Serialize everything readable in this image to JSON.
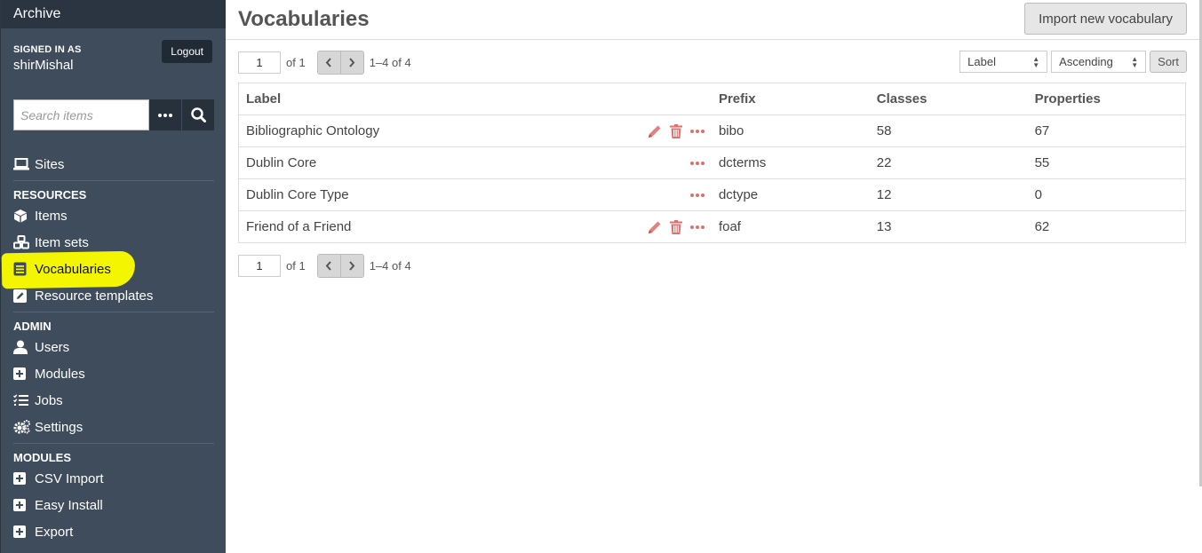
{
  "sidebar": {
    "site_title": "Archive",
    "signed_in_label": "SIGNED IN AS",
    "username": "shirMishal",
    "logout_label": "Logout",
    "search_placeholder": "Search items",
    "sites_label": "Sites",
    "resources_heading": "RESOURCES",
    "items_label": "Items",
    "item_sets_label": "Item sets",
    "vocabularies_label": "Vocabularies",
    "resource_templates_label": "Resource templates",
    "admin_heading": "ADMIN",
    "users_label": "Users",
    "modules_label": "Modules",
    "jobs_label": "Jobs",
    "settings_label": "Settings",
    "modules_heading": "MODULES",
    "csv_import_label": "CSV Import",
    "easy_install_label": "Easy Install",
    "export_label": "Export"
  },
  "header": {
    "title": "Vocabularies",
    "import_button": "Import new vocabulary"
  },
  "pagination": {
    "current_page": "1",
    "of_text": "of 1",
    "range_text": "1–4 of 4"
  },
  "sort": {
    "field": "Label",
    "order": "Ascending",
    "button": "Sort"
  },
  "table": {
    "headers": {
      "label": "Label",
      "prefix": "Prefix",
      "classes": "Classes",
      "properties": "Properties"
    },
    "rows": [
      {
        "label": "Bibliographic Ontology",
        "prefix": "bibo",
        "classes": "58",
        "properties": "67"
      },
      {
        "label": "Dublin Core",
        "prefix": "dcterms",
        "classes": "22",
        "properties": "55"
      },
      {
        "label": "Dublin Core Type",
        "prefix": "dctype",
        "classes": "12",
        "properties": "0"
      },
      {
        "label": "Friend of a Friend",
        "prefix": "foaf",
        "classes": "13",
        "properties": "62"
      }
    ]
  },
  "colors": {
    "sidebar_bg": "#3e4c5c",
    "accent_red": "#9b1c1c",
    "highlight": "#f4f500"
  },
  "icons": [
    "laptop-icon",
    "cube-icon",
    "cubes-icon",
    "book-icon",
    "pencil-square-icon",
    "user-icon",
    "plus-square-icon",
    "tasks-icon",
    "cogs-icon",
    "search-icon",
    "ellipsis-icon",
    "pencil-icon",
    "trash-icon",
    "chevron-left-icon",
    "chevron-right-icon"
  ]
}
